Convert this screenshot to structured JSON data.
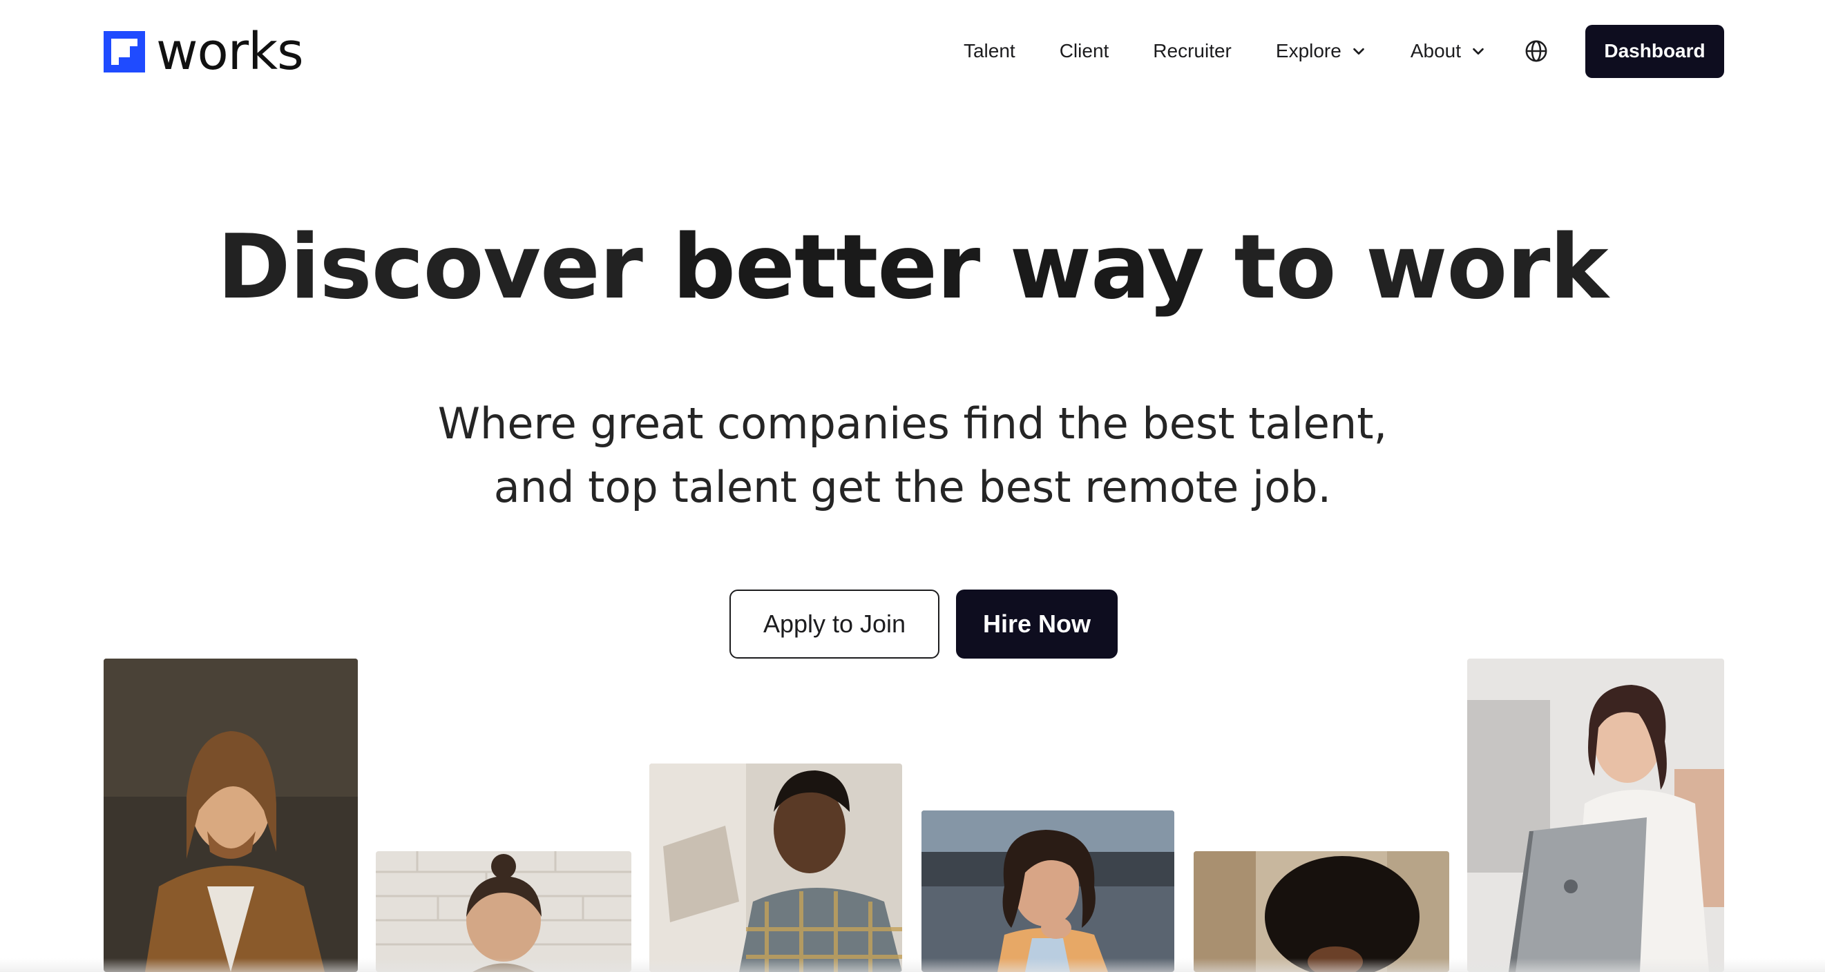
{
  "brand": {
    "name": "works",
    "accent": "#1f4bff"
  },
  "nav": {
    "items": [
      {
        "label": "Talent"
      },
      {
        "label": "Client"
      },
      {
        "label": "Recruiter"
      },
      {
        "label": "Explore",
        "dropdown": true
      },
      {
        "label": "About",
        "dropdown": true
      }
    ],
    "language_icon": "globe-icon",
    "dashboard_label": "Dashboard"
  },
  "hero": {
    "title_pre": "Discover ",
    "title_bold": "better way",
    "title_post": " to work",
    "subtitle_line1": "Where great companies find the best talent,",
    "subtitle_line2": "and top talent get the best remote job."
  },
  "cta": {
    "apply_label": "Apply to Join",
    "hire_label": "Hire Now"
  },
  "photos": [
    {
      "name": "talent-photo-man-long-hair"
    },
    {
      "name": "talent-photo-man-bun"
    },
    {
      "name": "talent-photo-man-plaid-shirt"
    },
    {
      "name": "talent-photo-woman-curly-hair"
    },
    {
      "name": "talent-photo-woman-afro"
    },
    {
      "name": "talent-photo-woman-laptop"
    }
  ],
  "colors": {
    "dark_button": "#0e0d1f",
    "text": "#1c1c1e"
  }
}
